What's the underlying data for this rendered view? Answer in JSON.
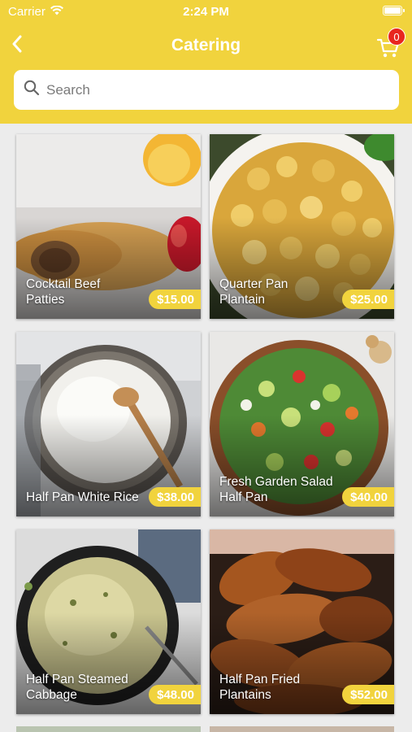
{
  "status_bar": {
    "carrier": "Carrier",
    "time": "2:24 PM"
  },
  "nav": {
    "title": "Catering",
    "cart_count": "0",
    "back_icon": "chevron-left-icon",
    "cart_icon": "cart-icon"
  },
  "search": {
    "placeholder": "Search",
    "value": ""
  },
  "colors": {
    "accent": "#f1d33d",
    "badge": "#e8261f"
  },
  "items": [
    {
      "name": "Cocktail Beef Patties",
      "price": "$15.00"
    },
    {
      "name": "Quarter Pan Plantain",
      "price": "$25.00"
    },
    {
      "name": "Half Pan White Rice",
      "price": "$38.00"
    },
    {
      "name": "Fresh Garden Salad Half Pan",
      "price": "$40.00"
    },
    {
      "name": "Half Pan Steamed Cabbage",
      "price": "$48.00"
    },
    {
      "name": "Half Pan Fried Plantains",
      "price": "$52.00"
    }
  ]
}
